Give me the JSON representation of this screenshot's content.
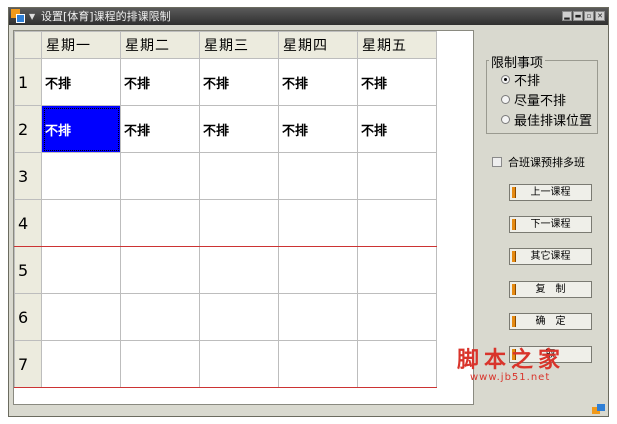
{
  "window": {
    "title": "设置[体育]课程的排课限制",
    "menu_glyph": "▼",
    "controls": [
      "▂",
      "▬",
      "▫",
      "✕"
    ]
  },
  "schedule": {
    "days": [
      "星期一",
      "星期二",
      "星期三",
      "星期四",
      "星期五"
    ],
    "rows": [
      {
        "period": "1",
        "cells": [
          "不排",
          "不排",
          "不排",
          "不排",
          "不排"
        ]
      },
      {
        "period": "2",
        "cells": [
          "不排",
          "不排",
          "不排",
          "不排",
          "不排"
        ]
      },
      {
        "period": "3",
        "cells": [
          "",
          "",
          "",
          "",
          ""
        ]
      },
      {
        "period": "4",
        "cells": [
          "",
          "",
          "",
          "",
          ""
        ]
      },
      {
        "period": "5",
        "cells": [
          "",
          "",
          "",
          "",
          ""
        ]
      },
      {
        "period": "6",
        "cells": [
          "",
          "",
          "",
          "",
          ""
        ]
      },
      {
        "period": "7",
        "cells": [
          "",
          "",
          "",
          "",
          ""
        ]
      }
    ],
    "selected_cell": {
      "row": 2,
      "day": "星期一"
    }
  },
  "restriction": {
    "legend": "限制事项",
    "options": [
      "不排",
      "尽量不排",
      "最佳排课位置"
    ],
    "selected": "不排"
  },
  "checkbox": {
    "label": "合班课预排多班",
    "checked": false
  },
  "buttons": {
    "prev": "上一课程",
    "next": "下一课程",
    "other": "其它课程",
    "copy": "复　制",
    "ok": "确　定",
    "close": "取"
  },
  "watermark": {
    "text": "脚本之家",
    "url": "www.jb51.net"
  },
  "colors": {
    "selected_cell": "#0000ff",
    "titlebar": "#3a3a3a",
    "panel": "#d9d9cf",
    "accent": "#e58a12",
    "divider_line": "#cc3333"
  }
}
